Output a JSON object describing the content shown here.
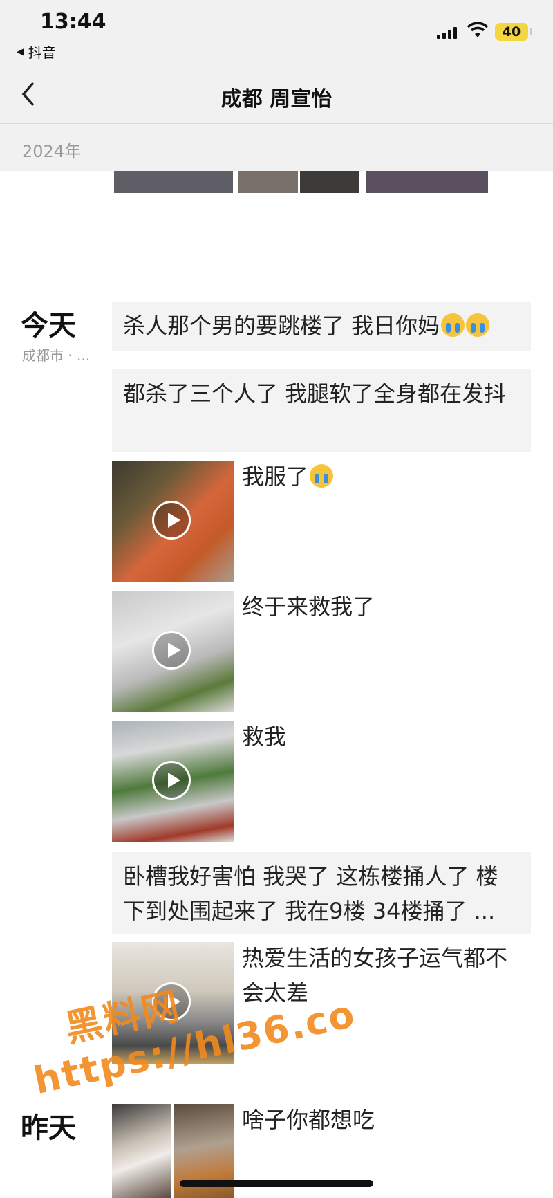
{
  "status_bar": {
    "time": "13:44",
    "back_app": "抖音",
    "battery": "40"
  },
  "nav": {
    "title": "成都 周宣怡"
  },
  "year_header": "2024年",
  "today": {
    "label": "今天",
    "location": "成都市 · ...",
    "posts": [
      {
        "type": "text",
        "text": "杀人那个男的要跳楼了 我日你妈",
        "emoji": [
          "loudly-crying-face",
          "loudly-crying-face"
        ]
      },
      {
        "type": "text",
        "text": "都杀了三个人了 我腿软了全身都在发抖"
      },
      {
        "type": "video",
        "caption": "我服了",
        "emoji": [
          "loudly-crying-face"
        ]
      },
      {
        "type": "video",
        "caption": "终于来救我了"
      },
      {
        "type": "video",
        "caption": "救我"
      },
      {
        "type": "text",
        "text": "卧槽我好害怕 我哭了 这栋楼捅人了 楼下到处围起来了 我在9楼 34楼捅了 ..."
      },
      {
        "type": "video",
        "caption": "热爱生活的女孩子运气都不会太差"
      }
    ]
  },
  "yesterday": {
    "label": "昨天",
    "posts": [
      {
        "type": "images",
        "caption": "啥子你都想吃"
      }
    ]
  },
  "watermark": {
    "line1": "黑料网",
    "line2": "https://hl36.co"
  },
  "colors": {
    "bubble": "#f3f3f3",
    "watermark": "#f28a1e",
    "battery": "#f4d640"
  }
}
